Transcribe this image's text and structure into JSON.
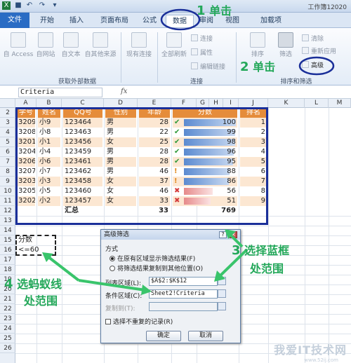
{
  "window": {
    "title": "工作簿12020"
  },
  "quick_access": {
    "icons": [
      "excel-icon",
      "save-icon",
      "undo-icon",
      "redo-icon",
      "customize-icon"
    ],
    "undo_glyph": "↶",
    "redo_glyph": "↷",
    "save_glyph": "■",
    "more_glyph": "▾"
  },
  "tabs": [
    "文件",
    "开始",
    "插入",
    "页面布局",
    "公式",
    "数据",
    "审阅",
    "视图",
    "加载项"
  ],
  "active_tab": "数据",
  "ribbon": {
    "get_external": {
      "label": "获取外部数据",
      "buttons": [
        "自 Access",
        "自网站",
        "自文本",
        "自其他来源"
      ]
    },
    "existing": "现有连接",
    "refresh": "全部刷新",
    "connections": {
      "label": "连接",
      "items": [
        "连接",
        "属性",
        "编辑链接"
      ]
    },
    "sort_filter": {
      "label": "排序和筛选",
      "sort": "排序",
      "filter": "筛选",
      "clear": "清除",
      "reapply": "重新应用",
      "advanced": "高级"
    }
  },
  "formula_bar": {
    "name_box": "Criteria",
    "fx": "fx"
  },
  "columns": [
    "A",
    "B",
    "C",
    "D",
    "E",
    "F",
    "G",
    "H",
    "I",
    "J",
    "K",
    "L",
    "M"
  ],
  "rows": [
    2,
    3,
    4,
    5,
    6,
    7,
    8,
    9,
    10,
    11,
    12,
    13,
    14,
    15,
    16,
    17,
    18,
    19,
    20,
    21,
    22,
    23,
    24,
    25,
    26
  ],
  "table": {
    "headers": [
      "学号",
      "姓名",
      "QQ号",
      "性别",
      "年龄",
      "分数",
      "排名"
    ],
    "records": [
      {
        "id": "3209",
        "name": "小9",
        "qq": "123464",
        "sex": "男",
        "age": "28",
        "score": "100",
        "rank": "1",
        "icon": "check"
      },
      {
        "id": "3208",
        "name": "小8",
        "qq": "123463",
        "sex": "男",
        "age": "22",
        "score": "99",
        "rank": "2",
        "icon": "check"
      },
      {
        "id": "3201",
        "name": "小1",
        "qq": "123456",
        "sex": "女",
        "age": "25",
        "score": "98",
        "rank": "3",
        "icon": "check"
      },
      {
        "id": "3204",
        "name": "小4",
        "qq": "123459",
        "sex": "男",
        "age": "28",
        "score": "96",
        "rank": "4",
        "icon": "check"
      },
      {
        "id": "3206",
        "name": "小6",
        "qq": "123461",
        "sex": "男",
        "age": "28",
        "score": "95",
        "rank": "5",
        "icon": "check"
      },
      {
        "id": "3207",
        "name": "小7",
        "qq": "123462",
        "sex": "男",
        "age": "46",
        "score": "88",
        "rank": "6",
        "icon": "warn"
      },
      {
        "id": "3203",
        "name": "小3",
        "qq": "123458",
        "sex": "女",
        "age": "37",
        "score": "86",
        "rank": "7",
        "icon": "warn"
      },
      {
        "id": "3205",
        "name": "小5",
        "qq": "123460",
        "sex": "女",
        "age": "46",
        "score": "56",
        "rank": "8",
        "icon": "cross"
      },
      {
        "id": "3202",
        "name": "小2",
        "qq": "123457",
        "sex": "女",
        "age": "33",
        "score": "51",
        "rank": "9",
        "icon": "cross"
      }
    ],
    "total_label": "汇总",
    "total_age": "33",
    "total_score": "769"
  },
  "criteria": {
    "header": "分数",
    "value": "<=60"
  },
  "dialog": {
    "title": "高级筛选",
    "help": "?",
    "close": "×",
    "method_label": "方式",
    "opt1": "在原有区域显示筛选结果(F)",
    "opt2": "将筛选结果复制到其他位置(O)",
    "list_label": "列表区域(L):",
    "list_value": "$A$2:$K$12",
    "crit_label": "条件区域(C):",
    "crit_value": "Sheet2!Criteria",
    "copy_label": "复制到(T):",
    "unique_label": "选择不重复的记录(R)",
    "ok": "确定",
    "cancel": "取消"
  },
  "annotations": {
    "step1": {
      "num": "1",
      "text": "单击"
    },
    "step2": {
      "num": "2",
      "text": "单击"
    },
    "step3": {
      "num": "3",
      "text": "选择蓝框",
      "text2": "处范围"
    },
    "step4": {
      "num": "4",
      "text": "选蚂蚁线",
      "text2": "处范围"
    },
    "color": "#24a85a"
  },
  "watermark": {
    "text": "我爱IT技术网",
    "url": "www.52ij.com"
  },
  "colors": {
    "header_fill": "#e58c3a",
    "stripe": "#fce7d2",
    "highlight_blue": "#1a2f99",
    "arrow_green": "#39c46b"
  }
}
